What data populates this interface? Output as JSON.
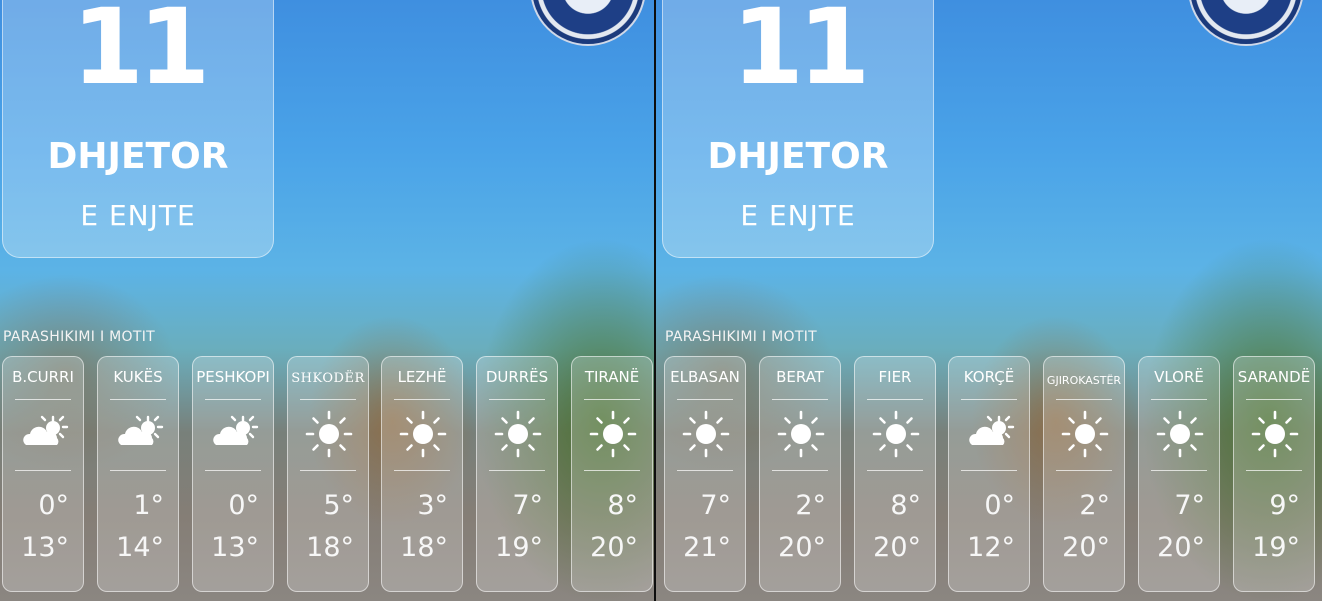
{
  "left": {
    "day": "11",
    "month": "DHJETOR",
    "weekday": "E ENJTE",
    "section_label": "PARASHIKIMI I MOTIT",
    "cities": [
      {
        "name": "B.CURRI",
        "icon": "partly-cloudy-icon",
        "min": "0°",
        "max": "13°"
      },
      {
        "name": "KUKËS",
        "icon": "partly-cloudy-icon",
        "min": "1°",
        "max": "14°"
      },
      {
        "name": "PESHKOPI",
        "icon": "partly-cloudy-icon",
        "min": "0°",
        "max": "13°"
      },
      {
        "name": "SHKODËR",
        "icon": "sun-icon",
        "min": "5°",
        "max": "18°"
      },
      {
        "name": "LEZHË",
        "icon": "sun-icon",
        "min": "3°",
        "max": "18°"
      },
      {
        "name": "DURRËS",
        "icon": "sun-icon",
        "min": "7°",
        "max": "19°"
      },
      {
        "name": "TIRANË",
        "icon": "sun-icon",
        "min": "8°",
        "max": "20°"
      }
    ]
  },
  "right": {
    "day": "11",
    "month": "DHJETOR",
    "weekday": "E ENJTE",
    "section_label": "PARASHIKIMI I MOTIT",
    "cities": [
      {
        "name": "ELBASAN",
        "icon": "sun-icon",
        "min": "7°",
        "max": "21°"
      },
      {
        "name": "BERAT",
        "icon": "sun-icon",
        "min": "2°",
        "max": "20°"
      },
      {
        "name": "FIER",
        "icon": "sun-icon",
        "min": "8°",
        "max": "20°"
      },
      {
        "name": "KORÇË",
        "icon": "partly-cloudy-icon",
        "min": "0°",
        "max": "12°"
      },
      {
        "name": "GJIROKASTËR",
        "icon": "sun-icon",
        "min": "2°",
        "max": "20°"
      },
      {
        "name": "VLORË",
        "icon": "sun-icon",
        "min": "7°",
        "max": "20°"
      },
      {
        "name": "SARANDË",
        "icon": "sun-icon",
        "min": "9°",
        "max": "19°"
      }
    ]
  },
  "colors": {
    "sky_top": "#3f8fe0",
    "card_glass": "rgba(255,255,255,0.22)",
    "text": "#ffffff"
  }
}
